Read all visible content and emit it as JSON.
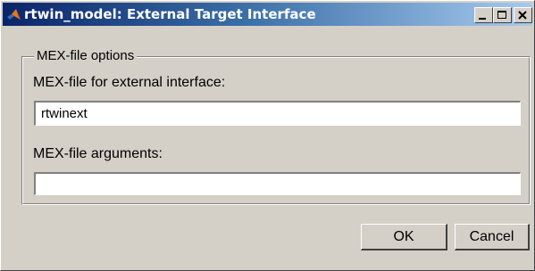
{
  "window": {
    "title": "rtwin_model: External Target Interface",
    "app_icon": "matlab-logo-icon",
    "controls": {
      "minimize_icon": "minimize-icon",
      "maximize_icon": "maximize-icon",
      "close_icon": "close-icon"
    }
  },
  "group": {
    "legend": "MEX-file options",
    "mex_file_label": "MEX-file for external interface:",
    "mex_file_value": "rtwinext",
    "mex_args_label": "MEX-file arguments:",
    "mex_args_value": ""
  },
  "buttons": {
    "ok": "OK",
    "cancel": "Cancel"
  },
  "colors": {
    "titlebar_start": "#0a246a",
    "titlebar_end": "#a6caf0",
    "face": "#d4d0c8"
  }
}
